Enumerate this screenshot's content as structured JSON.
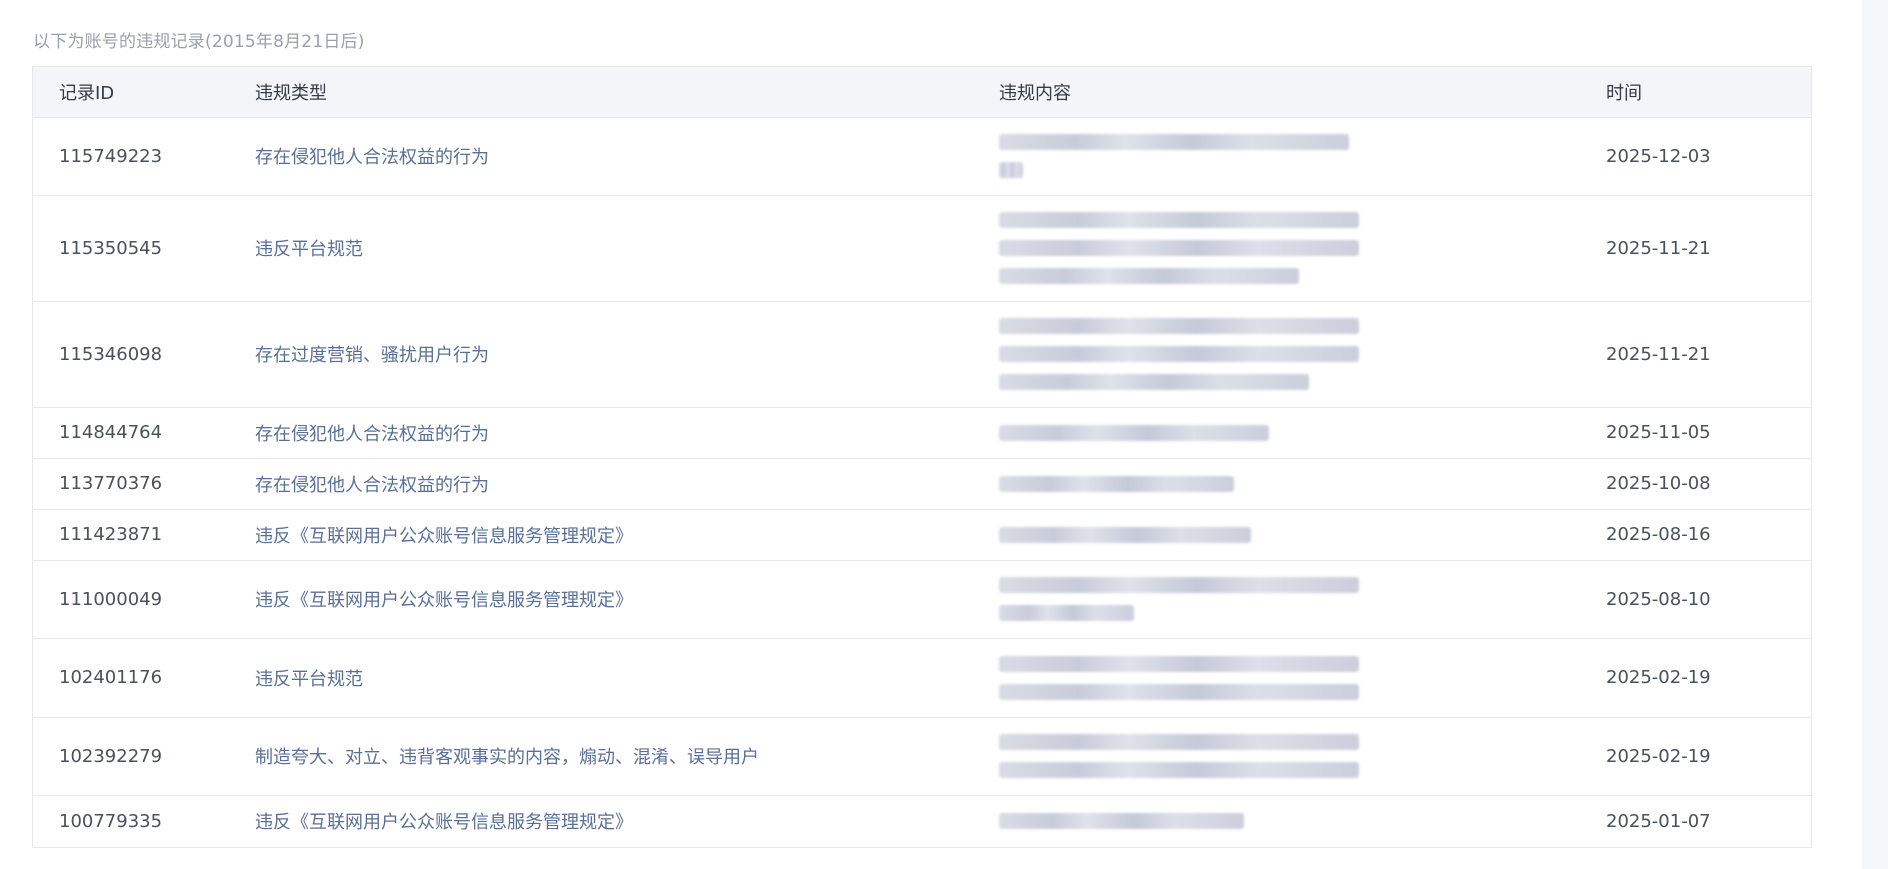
{
  "note": "以下为账号的违规记录(2015年8月21日后)",
  "table": {
    "headers": {
      "id": "记录ID",
      "type": "违规类型",
      "content": "违规内容",
      "time": "时间"
    },
    "rows": [
      {
        "id": "115749223",
        "type": "存在侵犯他人合法权益的行为",
        "time": "2025-12-03",
        "content_lines": 2
      },
      {
        "id": "115350545",
        "type": "违反平台规范",
        "time": "2025-11-21",
        "content_lines": 3
      },
      {
        "id": "115346098",
        "type": "存在过度营销、骚扰用户行为",
        "time": "2025-11-21",
        "content_lines": 3
      },
      {
        "id": "114844764",
        "type": "存在侵犯他人合法权益的行为",
        "time": "2025-11-05",
        "content_lines": 1
      },
      {
        "id": "113770376",
        "type": "存在侵犯他人合法权益的行为",
        "time": "2025-10-08",
        "content_lines": 1
      },
      {
        "id": "111423871",
        "type": "违反《互联网用户公众账号信息服务管理规定》",
        "time": "2025-08-16",
        "content_lines": 1
      },
      {
        "id": "111000049",
        "type": "违反《互联网用户公众账号信息服务管理规定》",
        "time": "2025-08-10",
        "content_lines": 2
      },
      {
        "id": "102401176",
        "type": "违反平台规范",
        "time": "2025-02-19",
        "content_lines": 2
      },
      {
        "id": "102392279",
        "type": "制造夸大、对立、违背客观事实的内容，煽动、混淆、误导用户",
        "time": "2025-02-19",
        "content_lines": 2
      },
      {
        "id": "100779335",
        "type": "违反《互联网用户公众账号信息服务管理规定》",
        "time": "2025-01-07",
        "content_lines": 1
      }
    ]
  },
  "colors": {
    "header_bg": "#f3f5f8",
    "border": "#e6e8ec",
    "type_text": "#5a6f97",
    "id_text": "#4a505c",
    "note_text": "#9aa0aa"
  }
}
